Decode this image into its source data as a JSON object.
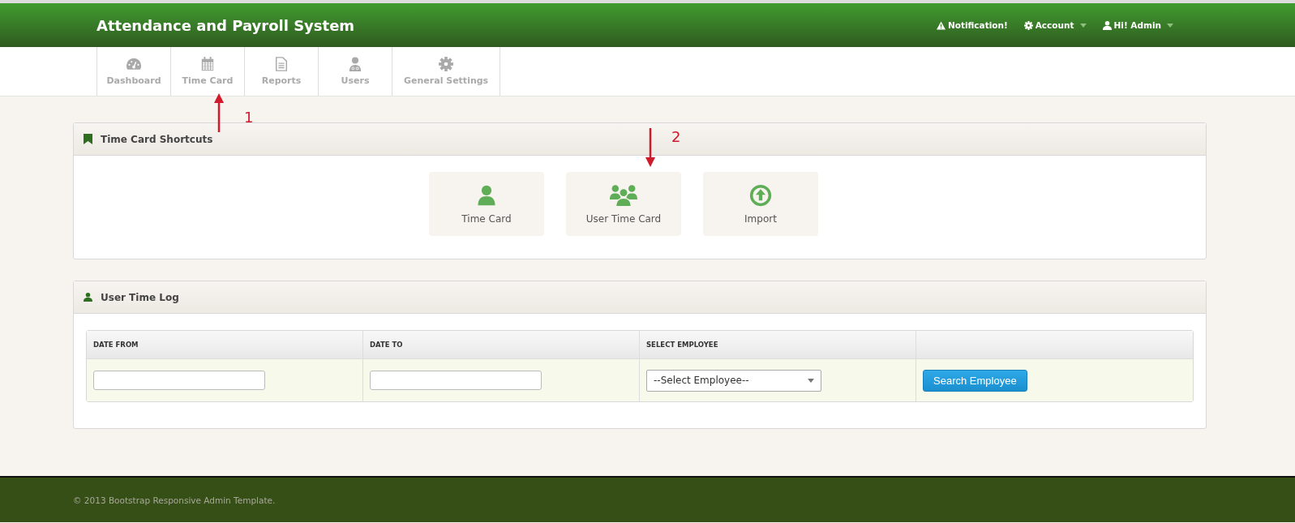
{
  "header": {
    "title": "Attendance and Payroll System",
    "links": [
      {
        "kind": "alert",
        "label": "Notification!",
        "dropdown": false
      },
      {
        "kind": "gear",
        "label": "Account",
        "dropdown": true
      },
      {
        "kind": "user",
        "label": "Hi! Admin",
        "dropdown": true
      }
    ]
  },
  "nav": [
    {
      "kind": "dashboard",
      "label": "Dashboard"
    },
    {
      "kind": "calendar",
      "label": "Time Card"
    },
    {
      "kind": "file",
      "label": "Reports"
    },
    {
      "kind": "users",
      "label": "Users"
    },
    {
      "kind": "gear",
      "label": "General Settings"
    }
  ],
  "shortcuts": {
    "title": "Time Card Shortcuts",
    "items": [
      {
        "kind": "user",
        "label": "Time Card"
      },
      {
        "kind": "group",
        "label": "User Time Card"
      },
      {
        "kind": "upload",
        "label": "Import"
      }
    ]
  },
  "time_log": {
    "title": "User Time Log",
    "columns": [
      "DATE FROM",
      "DATE TO",
      "SELECT EMPLOYEE",
      ""
    ],
    "select": "--Select Employee--",
    "button": "Search Employee"
  },
  "annotations": [
    {
      "label": "1",
      "kind": "up"
    },
    {
      "label": "2",
      "kind": "down"
    }
  ],
  "footer": "© 2013 Bootstrap Responsive Admin Template."
}
